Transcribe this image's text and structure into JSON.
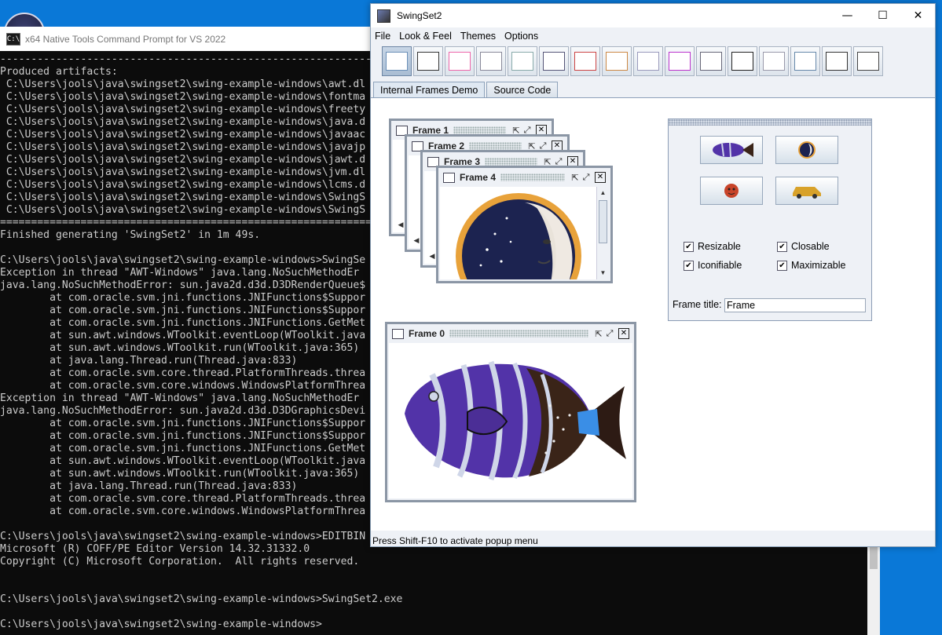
{
  "console": {
    "title": "x64 Native Tools Command Prompt for VS 2022",
    "lines": [
      "-----------------------------------------------------------------------------------------------------------------------------------------------",
      "Produced artifacts:",
      " C:\\Users\\jools\\java\\swingset2\\swing-example-windows\\awt.dl",
      " C:\\Users\\jools\\java\\swingset2\\swing-example-windows\\fontma",
      " C:\\Users\\jools\\java\\swingset2\\swing-example-windows\\freety",
      " C:\\Users\\jools\\java\\swingset2\\swing-example-windows\\java.d",
      " C:\\Users\\jools\\java\\swingset2\\swing-example-windows\\javaac",
      " C:\\Users\\jools\\java\\swingset2\\swing-example-windows\\javajp",
      " C:\\Users\\jools\\java\\swingset2\\swing-example-windows\\jawt.d",
      " C:\\Users\\jools\\java\\swingset2\\swing-example-windows\\jvm.dl",
      " C:\\Users\\jools\\java\\swingset2\\swing-example-windows\\lcms.d",
      " C:\\Users\\jools\\java\\swingset2\\swing-example-windows\\SwingS",
      " C:\\Users\\jools\\java\\swingset2\\swing-example-windows\\SwingS",
      "===============================================================================================================================================",
      "Finished generating 'SwingSet2' in 1m 49s.",
      "",
      "C:\\Users\\jools\\java\\swingset2\\swing-example-windows>SwingSe",
      "Exception in thread \"AWT-Windows\" java.lang.NoSuchMethodEr",
      "java.lang.NoSuchMethodError: sun.java2d.d3d.D3DRenderQueue$",
      "        at com.oracle.svm.jni.functions.JNIFunctions$Suppor",
      "        at com.oracle.svm.jni.functions.JNIFunctions$Suppor",
      "        at com.oracle.svm.jni.functions.JNIFunctions.GetMet",
      "        at sun.awt.windows.WToolkit.eventLoop(WToolkit.java",
      "        at sun.awt.windows.WToolkit.run(WToolkit.java:365)",
      "        at java.lang.Thread.run(Thread.java:833)",
      "        at com.oracle.svm.core.thread.PlatformThreads.threa",
      "        at com.oracle.svm.core.windows.WindowsPlatformThrea",
      "Exception in thread \"AWT-Windows\" java.lang.NoSuchMethodEr",
      "java.lang.NoSuchMethodError: sun.java2d.d3d.D3DGraphicsDevi",
      "        at com.oracle.svm.jni.functions.JNIFunctions$Suppor",
      "        at com.oracle.svm.jni.functions.JNIFunctions$Suppor",
      "        at com.oracle.svm.jni.functions.JNIFunctions.GetMet",
      "        at sun.awt.windows.WToolkit.eventLoop(WToolkit.java",
      "        at sun.awt.windows.WToolkit.run(WToolkit.java:365)",
      "        at java.lang.Thread.run(Thread.java:833)",
      "        at com.oracle.svm.core.thread.PlatformThreads.threa",
      "        at com.oracle.svm.core.windows.WindowsPlatformThrea",
      "",
      "C:\\Users\\jools\\java\\swingset2\\swing-example-windows>EDITBIN",
      "Microsoft (R) COFF/PE Editor Version 14.32.31332.0",
      "Copyright (C) Microsoft Corporation.  All rights reserved.",
      "",
      "",
      "C:\\Users\\jools\\java\\swingset2\\swing-example-windows>SwingSet2.exe",
      "",
      "C:\\Users\\jools\\java\\swingset2\\swing-example-windows>"
    ]
  },
  "swing": {
    "title": "SwingSet2",
    "menu": [
      "File",
      "Look & Feel",
      "Themes",
      "Options"
    ],
    "toolbar_icons": [
      "internal-frames-icon",
      "checkbox-radio-icon",
      "filechooser-icon",
      "combobox-icon",
      "list-icon",
      "editorpane-icon",
      "colorchooser-icon",
      "optionpane-icon",
      "progressbar-icon",
      "html-icon",
      "slider-icon",
      "splitpane-icon",
      "tabbedpane-icon",
      "table-icon",
      "button-ok-icon",
      "tree-icon"
    ],
    "tabs": [
      "Internal Frames Demo",
      "Source Code"
    ],
    "status": "Press Shift-F10 to activate popup menu",
    "frames": [
      {
        "title": "Frame 1"
      },
      {
        "title": "Frame 2"
      },
      {
        "title": "Frame 3"
      },
      {
        "title": "Frame 4"
      },
      {
        "title": "Frame 0"
      }
    ],
    "checkboxes": [
      {
        "label": "Resizable",
        "checked": true
      },
      {
        "label": "Closable",
        "checked": true
      },
      {
        "label": "Iconifiable",
        "checked": true
      },
      {
        "label": "Maximizable",
        "checked": true
      }
    ],
    "frame_title_label": "Frame title:",
    "frame_title_value": "Frame"
  }
}
